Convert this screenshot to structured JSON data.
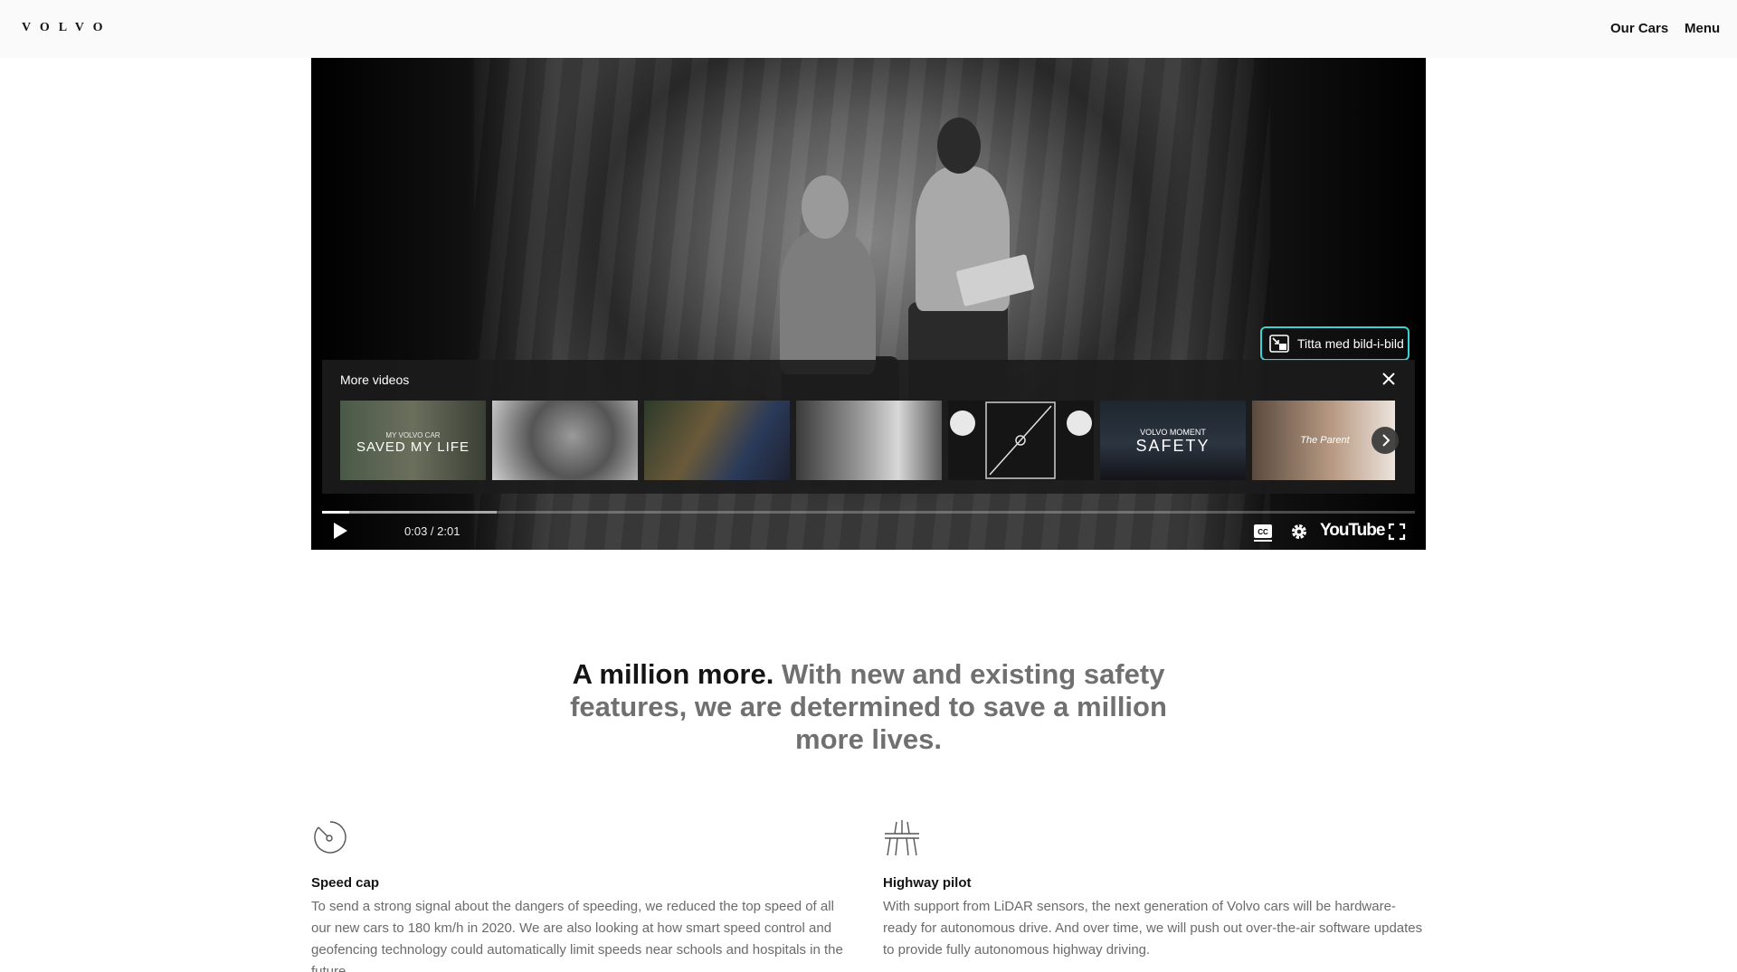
{
  "header": {
    "logo": "VOLVO",
    "nav": {
      "our_cars": "Our Cars",
      "menu": "Menu"
    }
  },
  "player": {
    "pip_label": "Titta med bild-i-bild",
    "more_videos_title": "More videos",
    "thumbnails": [
      {
        "small": "MY VOLVO CAR",
        "big": "SAVED MY LIFE"
      },
      {
        "small": "",
        "big": ""
      },
      {
        "small": "",
        "big": ""
      },
      {
        "small": "",
        "big": ""
      },
      {
        "small": "",
        "big": ""
      },
      {
        "small": "VOLVO MOMENT",
        "big": "SAFETY"
      },
      {
        "small": "",
        "big": "The Parent"
      }
    ],
    "time": "0:03 / 2:01",
    "progress_fraction": 0.025,
    "buffered_fraction": 0.16,
    "youtube_label": "YouTube",
    "icons": [
      "play-icon",
      "cc-icon",
      "settings-icon",
      "youtube-logo",
      "fullscreen-icon",
      "close-icon",
      "chevron-right-icon",
      "pip-icon"
    ]
  },
  "headline": {
    "strong": "A million more.",
    "rest": "With new and existing safety features, we are determined to save a million more lives."
  },
  "features": [
    {
      "icon": "speedometer-icon",
      "title": "Speed cap",
      "body": "To send a strong signal about the dangers of speeding, we reduced the top speed of all our new cars to 180 km/h in 2020. We are also looking at how smart speed control and geofencing technology could automatically limit speeds near schools and hospitals in the future."
    },
    {
      "icon": "highway-icon",
      "title": "Highway pilot",
      "body": "With support from LiDAR sensors, the next generation of Volvo cars will be hardware-ready for autonomous drive. And over time, we will push out over-the-air software updates to provide fully autonomous highway driving."
    }
  ],
  "colors": {
    "pip_border": "#3fd0d0",
    "header_bg": "#fafafa",
    "muted_text": "#707070"
  }
}
